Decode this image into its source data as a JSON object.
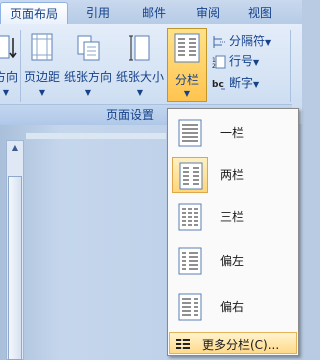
{
  "tabs": [
    {
      "label": "页面布局",
      "active": true
    },
    {
      "label": "引用",
      "active": false
    },
    {
      "label": "邮件",
      "active": false
    },
    {
      "label": "审阅",
      "active": false
    },
    {
      "label": "视图",
      "active": false
    }
  ],
  "ribbon": {
    "buttons": [
      {
        "label": "方向",
        "icon": "orientation-icon"
      },
      {
        "label": "页边距",
        "icon": "margins-icon"
      },
      {
        "label": "纸张方向",
        "icon": "paper-orientation-icon"
      },
      {
        "label": "纸张大小",
        "icon": "paper-size-icon"
      },
      {
        "label": "分栏",
        "icon": "columns-icon",
        "pressed": true
      }
    ],
    "small": [
      {
        "label": "分隔符",
        "icon": "breaks-icon"
      },
      {
        "label": "行号",
        "icon": "line-numbers-icon"
      },
      {
        "label": "断字",
        "icon": "hyphenation-icon"
      }
    ],
    "group_label": "页面设置",
    "dropdown_arrow": "▼"
  },
  "menu": {
    "items": [
      {
        "label": "一栏",
        "icon": "one-column-icon",
        "selected": false
      },
      {
        "label": "两栏",
        "icon": "two-columns-icon",
        "selected": true
      },
      {
        "label": "三栏",
        "icon": "three-columns-icon",
        "selected": false
      },
      {
        "label": "偏左",
        "icon": "left-column-icon",
        "selected": false
      },
      {
        "label": "偏右",
        "icon": "right-column-icon",
        "selected": false
      }
    ],
    "more": {
      "label": "更多分栏(C)...",
      "icon": "more-columns-icon"
    }
  },
  "colors": {
    "accent": "#ffc44f",
    "tab_text": "#15428b",
    "ribbon": "#d5e3f4"
  }
}
